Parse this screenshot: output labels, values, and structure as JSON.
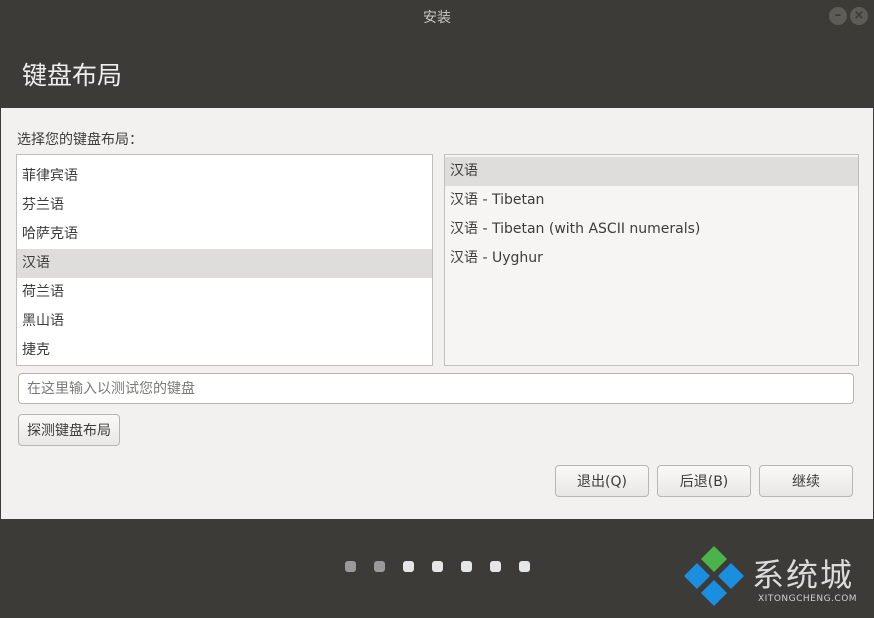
{
  "window": {
    "title": "安装",
    "minimize_glyph": "–",
    "close_glyph": "×"
  },
  "header": {
    "title": "键盘布局"
  },
  "content": {
    "prompt": "选择您的键盘布局：",
    "languages": [
      "菲律宾语",
      "芬兰语",
      "哈萨克语",
      "汉语",
      "荷兰语",
      "黑山语",
      "捷克"
    ],
    "selected_language": "汉语",
    "variants": [
      "汉语",
      "汉语 - Tibetan",
      "汉语 - Tibetan (with ASCII numerals)",
      "汉语 - Uyghur"
    ],
    "selected_variant": "汉语",
    "test_placeholder": "在这里输入以测试您的键盘",
    "detect_label": "探测键盘布局"
  },
  "buttons": {
    "quit": "退出(Q)",
    "back": "后退(B)",
    "continue": "继续"
  },
  "progress": {
    "total_steps": 7,
    "completed_steps": 2,
    "dot_done_color": "#9a9a9a",
    "dot_todo_color": "#e6e6e6"
  },
  "watermark": {
    "cn": "系统城",
    "en": "XITONGCHENG.COM",
    "colors": [
      "#4bb34b",
      "#1a8fe0",
      "#1a8fe0",
      "#1a8fe0"
    ]
  }
}
